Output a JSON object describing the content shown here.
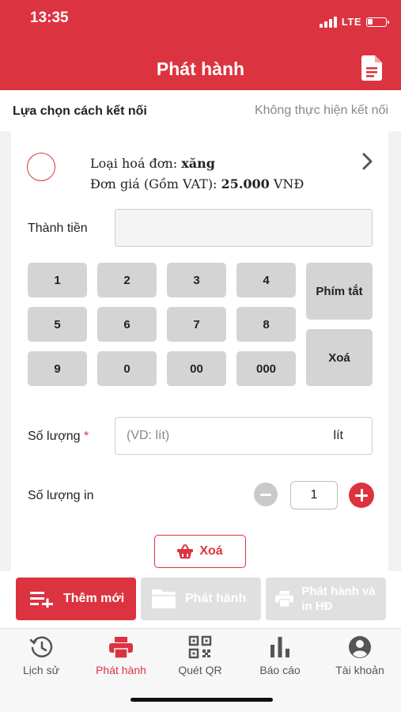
{
  "status": {
    "time": "13:35",
    "network": "LTE"
  },
  "header": {
    "title": "Phát hành",
    "doc_icon": "document-icon"
  },
  "connection": {
    "label": "Lựa chọn cách kết nối",
    "status": "Không thực hiện kết nối"
  },
  "invoice": {
    "type_label": "Loại hoá đơn:",
    "type_value": "xăng",
    "price_label": "Đơn giá (Gồm VAT):",
    "price_value": "25.000",
    "price_unit": "VNĐ"
  },
  "amount": {
    "label": "Thành tiền",
    "value": ""
  },
  "keypad": {
    "keys": [
      "1",
      "2",
      "3",
      "4",
      "5",
      "6",
      "7",
      "8",
      "9",
      "0",
      "00",
      "000"
    ],
    "shortcut_label": "Phím tắt",
    "delete_label": "Xoá"
  },
  "quantity": {
    "label": "Số lượng",
    "required_mark": "*",
    "placeholder": "(VD: lít)",
    "unit": "lít"
  },
  "print_qty": {
    "label": "Số lượng in",
    "value": "1"
  },
  "clear_button": {
    "label": "Xoá"
  },
  "actions": {
    "add_new": "Thêm mới",
    "issue": "Phát hành",
    "issue_print": "Phát hành và in HĐ"
  },
  "tabs": [
    {
      "label": "Lịch sử",
      "icon": "history-icon"
    },
    {
      "label": "Phát hành",
      "icon": "printer-icon"
    },
    {
      "label": "Quét QR",
      "icon": "qr-icon"
    },
    {
      "label": "Báo cáo",
      "icon": "chart-icon"
    },
    {
      "label": "Tài khoản",
      "icon": "account-icon"
    }
  ],
  "colors": {
    "accent": "#dc3340",
    "disabled": "#e0e0e0"
  }
}
